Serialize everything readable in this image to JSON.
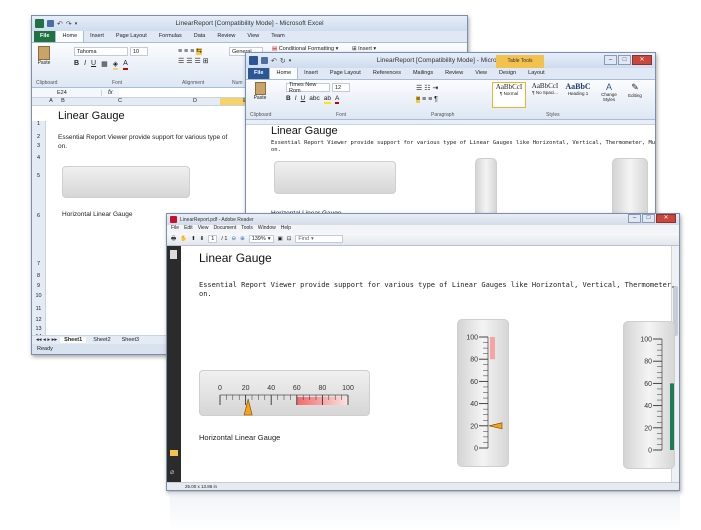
{
  "colors": {
    "excel_green": "#207245",
    "word_blue": "#2b5797",
    "tab_blue": "#3e6ab4",
    "contextual": "#f2c14e",
    "accent_orange": "#f7a21b",
    "gauge_red": "#f26a6a",
    "pdf_red": "#c8102e",
    "excel_select": "#f6d365"
  },
  "excel": {
    "title": "LinearReport [Compatibility Mode] - Microsoft Excel",
    "tabs": [
      "File",
      "Home",
      "Insert",
      "Page Layout",
      "Formulas",
      "Data",
      "Review",
      "View",
      "Team"
    ],
    "font_name": "Tahoma",
    "font_size": "10",
    "number_format": "General",
    "groups": [
      "Clipboard",
      "Font",
      "Alignment",
      "Num"
    ],
    "paste_label": "Paste",
    "styles": [
      "Conditional Formatting",
      "Insert"
    ],
    "cell_ref": "E24",
    "fx": "fx",
    "columns": [
      "A",
      "B",
      "C",
      "D",
      "E"
    ],
    "rows": [
      "1",
      "2",
      "3",
      "4",
      "5",
      "6",
      "7",
      "8",
      "9",
      "10",
      "11",
      "12",
      "13",
      "14"
    ],
    "heading": "Linear Gauge",
    "text": "Essential Report Viewer provide support for various type of",
    "text2": "on.",
    "gauge_caption": "Horizontal Linear Gauge",
    "sheets": [
      "Sheet1",
      "Sheet2",
      "Sheet3"
    ],
    "status": "Ready",
    "selected_row": "6"
  },
  "word": {
    "title": "LinearReport [Compatibility Mode] - Microsoft Word",
    "contextual": "Table Tools",
    "tabs": [
      "File",
      "Home",
      "Insert",
      "Page Layout",
      "References",
      "Mailings",
      "Review",
      "View",
      "Design",
      "Layout"
    ],
    "font_name": "Times New Rom",
    "font_size": "12",
    "groups": [
      "Clipboard",
      "Font",
      "Paragraph",
      "Styles"
    ],
    "paste_label": "Paste",
    "styles": [
      {
        "sample": "AaBbCcI",
        "name": "¶ Normal"
      },
      {
        "sample": "AaBbCcI",
        "name": "¶ No Spaci..."
      },
      {
        "sample": "AaBbC",
        "name": "Heading 1"
      }
    ],
    "change_styles": "Change Styles",
    "editing": "Editing",
    "heading": "Linear Gauge",
    "text": "Essential Report Viewer provide support for various type of Linear Gauges like Horizontal, Vertical, Thermometer, Mu",
    "text2": "on.",
    "gauge_caption": "Horizontal Linear Gauge"
  },
  "pdf": {
    "title": "LinearReport.pdf - Adobe Reader",
    "menu": [
      "File",
      "Edit",
      "View",
      "Document",
      "Tools",
      "Window",
      "Help"
    ],
    "page_current": "1",
    "page_total": "/ 1",
    "zoom": "139%",
    "find": "Find",
    "heading": "Linear Gauge",
    "text": "Essential Report Viewer provide support for various type of Linear Gauges like Horizontal, Vertical, Thermometer, Mult",
    "text2": "on.",
    "gauge_caption": "Horizontal Linear Gauge",
    "page_size": "25.00 x 13.86 in"
  },
  "gauge": {
    "ticks": [
      "0",
      "20",
      "40",
      "60",
      "80",
      "100"
    ],
    "pointer_value": 22,
    "range_start": 60,
    "range_end": 100
  },
  "vgauge": {
    "ticks": [
      "100",
      "80",
      "60",
      "40",
      "20",
      "0"
    ],
    "pointer_value": 20,
    "range_start": 80,
    "range_end": 100
  }
}
